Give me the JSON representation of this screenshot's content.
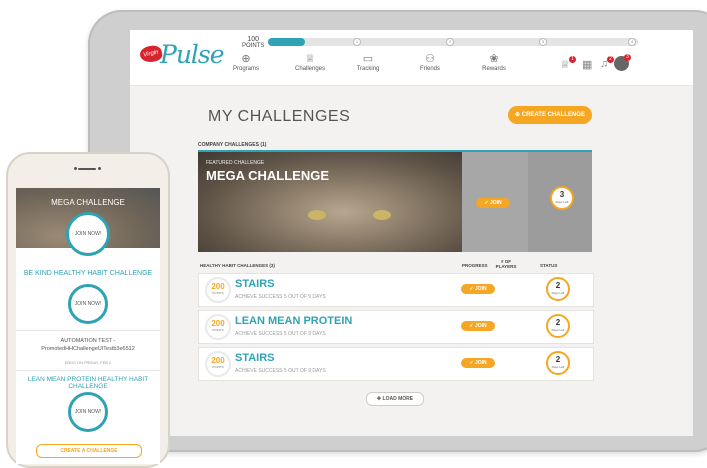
{
  "app": {
    "brand_small": "Virgin",
    "brand": "Pulse"
  },
  "header": {
    "points_value": "100",
    "points_label": "POINTS",
    "progress_fraction": 0.1,
    "milestones": [
      "1",
      "2",
      "3",
      "4",
      "5"
    ],
    "nav": [
      {
        "label": "Programs",
        "icon": "globe-icon",
        "glyph": "⊕"
      },
      {
        "label": "Challenges",
        "icon": "trophy-icon",
        "glyph": "♕"
      },
      {
        "label": "Tracking",
        "icon": "calendar-icon",
        "glyph": "▭"
      },
      {
        "label": "Friends",
        "icon": "people-icon",
        "glyph": "⚇"
      },
      {
        "label": "Rewards",
        "icon": "medal-icon",
        "glyph": "❀"
      }
    ],
    "notif_trophy": "1",
    "notif_bell": "2",
    "notif_avatar": "3"
  },
  "page": {
    "title": "MY CHALLENGES",
    "create_button": "CREATE CHALLENGE",
    "company_section": "COMPANY CHALLENGES (1)",
    "featured": {
      "label": "FEATURED CHALLENGE",
      "title": "MEGA CHALLENGE",
      "join": "JOIN",
      "days": "3",
      "days_label": "Days Left"
    },
    "habit_section": "HEALTHY HABIT CHALLENGES (3)",
    "col_progress": "PROGRESS",
    "col_players": "# OF PLAYERS",
    "col_status": "STATUS",
    "rows": [
      {
        "points": "200",
        "points_label": "POINTS",
        "title": "STAIRS",
        "subtitle": "ACHIEVE SUCCESS 5 OUT OF 9 DAYS",
        "join": "JOIN",
        "days": "2",
        "days_label": "Days Left"
      },
      {
        "points": "200",
        "points_label": "POINTS",
        "title": "LEAN MEAN PROTEIN",
        "subtitle": "ACHIEVE SUCCESS 5 OUT OF 9 DAYS",
        "join": "JOIN",
        "days": "2",
        "days_label": "Days Left"
      },
      {
        "points": "200",
        "points_label": "POINTS",
        "title": "STAIRS",
        "subtitle": "ACHIEVE SUCCESS 5 OUT OF 9 DAYS",
        "join": "JOIN",
        "days": "2",
        "days_label": "Days Left"
      }
    ],
    "load_more": "LOAD MORE"
  },
  "phone": {
    "hero_title": "MEGA CHALLENGE",
    "hero_join": "JOIN NOW!",
    "card1_title": "BE KIND HEALTHY HABIT CHALLENGE",
    "card1_join": "JOIN NOW!",
    "card2_line1": "AUTOMATION TEST -",
    "card2_line2": "PromotedHHChallengeUITestb3e6512",
    "card2_small": "ENDS ON FRIDAY, FEB 2",
    "card3_title": "LEAN MEAN PROTEIN HEALTHY HABIT CHALLENGE",
    "card3_join": "JOIN NOW!",
    "create": "CREATE A CHALLENGE"
  },
  "colors": {
    "accent": "#2fa3b5",
    "orange": "#f5a623",
    "red": "#d8242f"
  }
}
